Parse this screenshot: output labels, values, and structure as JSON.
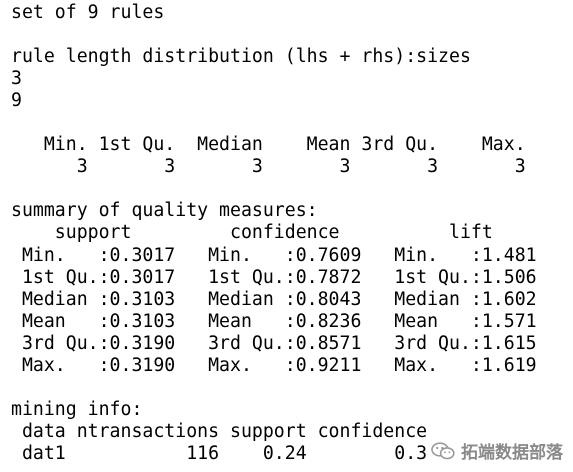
{
  "console": {
    "lines": [
      "set of 9 rules",
      "",
      "rule length distribution (lhs + rhs):sizes",
      "3",
      "9",
      "",
      "   Min. 1st Qu.  Median    Mean 3rd Qu.    Max.",
      "      3       3       3       3       3       3",
      "",
      "summary of quality measures:",
      "    support         confidence          lift      ",
      " Min.   :0.3017   Min.   :0.7609   Min.   :1.481  ",
      " 1st Qu.:0.3017   1st Qu.:0.7872   1st Qu.:1.506  ",
      " Median :0.3103   Median :0.8043   Median :1.602  ",
      " Mean   :0.3103   Mean   :0.8236   Mean   :1.571  ",
      " 3rd Qu.:0.3190   3rd Qu.:0.8571   3rd Qu.:1.615  ",
      " Max.   :0.3190   Max.   :0.9211   Max.   :1.619  ",
      "",
      "mining info:",
      " data ntransactions support confidence",
      " dat1           116    0.24        0.3"
    ]
  },
  "watermark": {
    "text": "拓端数据部落",
    "icon": "wechat-icon"
  }
}
